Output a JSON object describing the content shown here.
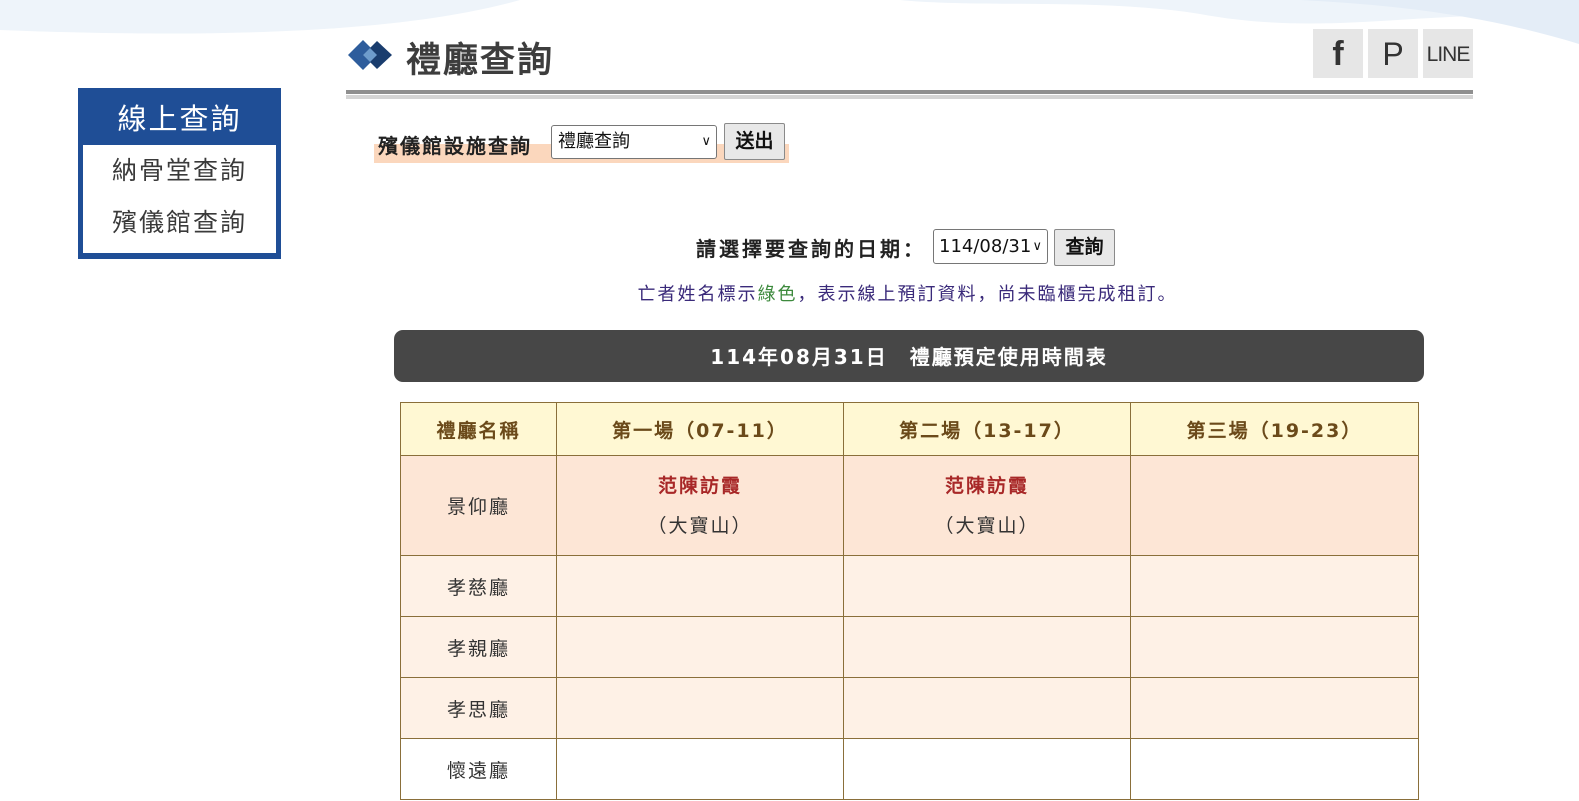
{
  "header": {
    "title": "禮廳查詢",
    "share": {
      "facebook": "f",
      "pinterest": "P",
      "line": "LINE"
    }
  },
  "sidebar": {
    "title": "線上查詢",
    "items": [
      {
        "label": "納骨堂查詢"
      },
      {
        "label": "殯儀館查詢"
      }
    ]
  },
  "facility_query": {
    "label": "殯儀館設施查詢",
    "selected": "禮廳查詢",
    "submit_label": "送出"
  },
  "date_query": {
    "label": "請選擇要查詢的日期：",
    "selected": "114/08/31",
    "query_label": "查詢"
  },
  "note": {
    "before": "亡者姓名標示",
    "green": "綠色",
    "after": "，表示線上預訂資料，尚未臨櫃完成租訂。"
  },
  "schedule": {
    "banner": "114年08月31日　禮廳預定使用時間表",
    "headers": [
      "禮廳名稱",
      "第一場（07-11）",
      "第二場（13-17）",
      "第三場（19-23）"
    ],
    "rows": [
      {
        "hall": "景仰廳",
        "slots": [
          {
            "name": "范陳訪霞",
            "location": "（大寶山）"
          },
          {
            "name": "范陳訪霞",
            "location": "（大寶山）"
          },
          {
            "name": "",
            "location": ""
          }
        ]
      },
      {
        "hall": "孝慈廳"
      },
      {
        "hall": "孝親廳"
      },
      {
        "hall": "孝思廳"
      },
      {
        "hall": "懷遠廳"
      }
    ]
  },
  "colors": {
    "sidebar": "#1f4e96",
    "banner": "#474747",
    "header_row": "#fff8d3",
    "booking_name": "#a82828",
    "note_green": "#3d8a3d"
  }
}
